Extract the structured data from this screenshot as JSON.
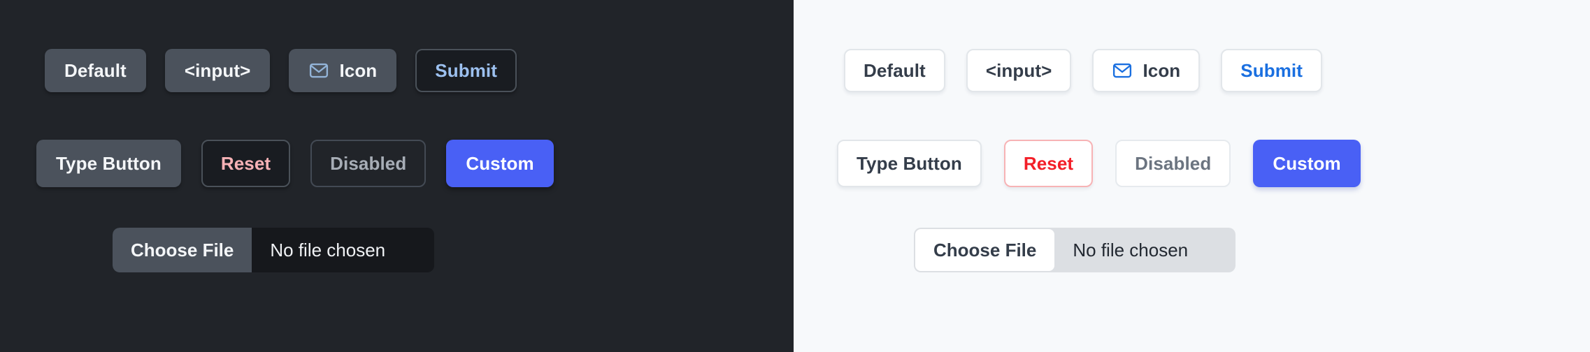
{
  "themes": {
    "dark": {
      "background": "#212429",
      "row1": [
        {
          "label": "Default",
          "name": "default-button"
        },
        {
          "label": "<input>",
          "name": "input-button"
        },
        {
          "label": "Icon",
          "name": "icon-button",
          "icon": "envelope-icon"
        },
        {
          "label": "Submit",
          "name": "submit-button"
        }
      ],
      "row2": [
        {
          "label": "Type Button",
          "name": "type-button"
        },
        {
          "label": "Reset",
          "name": "reset-button"
        },
        {
          "label": "Disabled",
          "name": "disabled-button"
        },
        {
          "label": "Custom",
          "name": "custom-button"
        }
      ],
      "file_input": {
        "button_label": "Choose File",
        "status_text": "No file chosen"
      },
      "colors": {
        "solid_bg": "#4b525c",
        "solid_text": "#f4f6f8",
        "submit_text": "#9cc0ef",
        "reset_text": "#f7b2b6",
        "disabled_text": "#a7adb6",
        "custom_bg": "#4960f5",
        "custom_text": "#ffffff",
        "icon_stroke": "#93b4d8",
        "border": "#4a5159"
      }
    },
    "light": {
      "background": "#f7f9fb",
      "row1": [
        {
          "label": "Default",
          "name": "default-button"
        },
        {
          "label": "<input>",
          "name": "input-button"
        },
        {
          "label": "Icon",
          "name": "icon-button",
          "icon": "envelope-icon"
        },
        {
          "label": "Submit",
          "name": "submit-button"
        }
      ],
      "row2": [
        {
          "label": "Type Button",
          "name": "type-button"
        },
        {
          "label": "Reset",
          "name": "reset-button"
        },
        {
          "label": "Disabled",
          "name": "disabled-button"
        },
        {
          "label": "Custom",
          "name": "custom-button"
        }
      ],
      "file_input": {
        "button_label": "Choose File",
        "status_text": "No file chosen"
      },
      "colors": {
        "solid_bg": "#ffffff",
        "solid_text": "#343d4a",
        "submit_text": "#1a6fe0",
        "reset_text": "#f31f28",
        "reset_border": "#f7b3b5",
        "disabled_text": "#6b7480",
        "custom_bg": "#4960f5",
        "custom_text": "#ffffff",
        "icon_stroke": "#1a6fe0",
        "border": "#e2e6ea"
      }
    }
  }
}
